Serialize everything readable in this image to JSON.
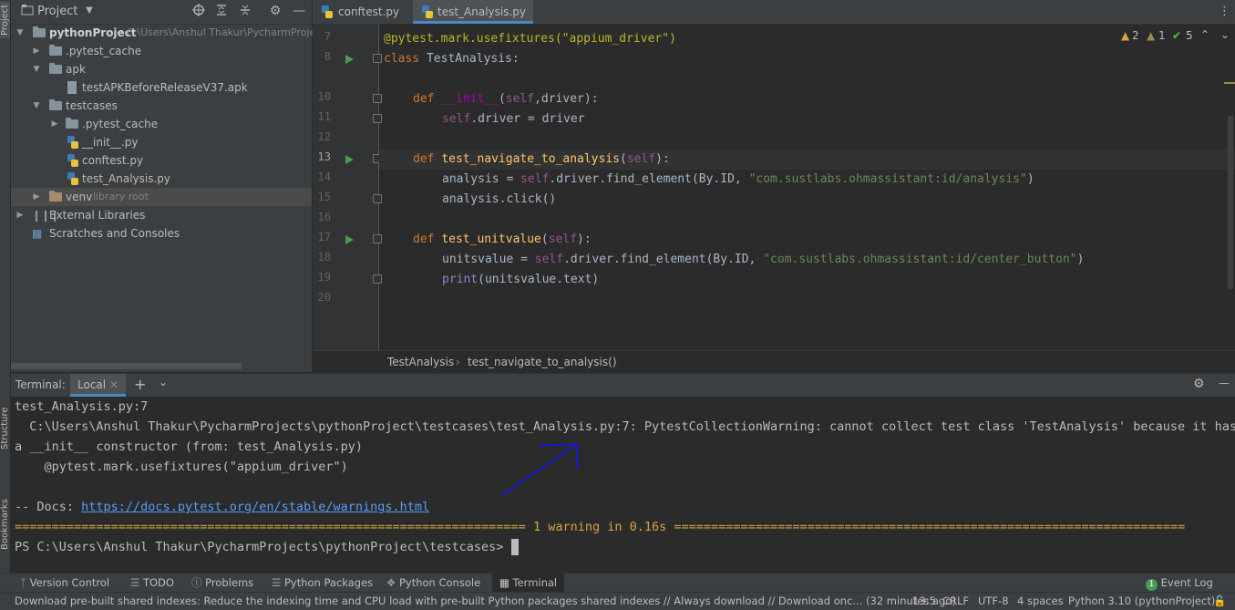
{
  "left_strip": {
    "project_label": "Project",
    "structure_label": "Structure",
    "bookmarks_label": "Bookmarks"
  },
  "project_panel": {
    "title": "Project",
    "tree": [
      {
        "label": "pythonProject",
        "path": "C:\\Users\\Anshul Thakur\\PycharmProje",
        "bold": true
      },
      {
        "label": ".pytest_cache"
      },
      {
        "label": "apk"
      },
      {
        "label": "testAPKBeforeReleaseV37.apk"
      },
      {
        "label": "testcases"
      },
      {
        "label": ".pytest_cache"
      },
      {
        "label": "__init__.py"
      },
      {
        "label": "conftest.py"
      },
      {
        "label": "test_Analysis.py"
      },
      {
        "label": "venv",
        "suffix": "library root"
      },
      {
        "label": "External Libraries"
      },
      {
        "label": "Scratches and Consoles"
      }
    ]
  },
  "editor": {
    "tabs": [
      {
        "label": "conftest.py"
      },
      {
        "label": "test_Analysis.py"
      }
    ],
    "inspections": {
      "warnings": "2",
      "weak": "1",
      "ok": "5"
    },
    "lines": [
      "7",
      "8",
      "10",
      "11",
      "12",
      "13",
      "14",
      "15",
      "16",
      "17",
      "18",
      "19",
      "20"
    ],
    "breadcrumb": [
      "TestAnalysis",
      "test_navigate_to_analysis()"
    ]
  },
  "code": {
    "l7": "@pytest.mark.usefixtures(\"appium_driver\")",
    "l8_kw": "class",
    "l8_name": " TestAnalysis:",
    "l10_def": "def",
    "l10_fn": "__init__",
    "l10_rest_open": "(",
    "l10_self": "self",
    "l10_rest": ",driver):",
    "l11_self": "self",
    "l11_rest": ".driver = driver",
    "l13_def": "def",
    "l13_fn": "test_navigate_to_analysis",
    "l13_open": "(",
    "l13_self": "self",
    "l13_close": "):",
    "l14_a": "analysis = ",
    "l14_self": "self",
    "l14_b": ".driver.find_element(By.ID, ",
    "l14_str": "\"com.sustlabs.ohmassistant:id/analysis\"",
    "l14_c": ")",
    "l15": "analysis.click()",
    "l17_def": "def",
    "l17_fn": "test_unitvalue",
    "l17_open": "(",
    "l17_self": "self",
    "l17_close": "):",
    "l18_a": "unitsvalue = ",
    "l18_self": "self",
    "l18_b": ".driver.find_element(By.ID, ",
    "l18_str": "\"com.sustlabs.ohmassistant:id/center_button\"",
    "l18_c": ")",
    "l19_kw": "print",
    "l19_rest": "(unitsvalue.text)"
  },
  "terminal": {
    "title": "Terminal:",
    "tab": "Local",
    "lines": {
      "t1": "test_Analysis.py:7",
      "t2": "  C:\\Users\\Anshul Thakur\\PycharmProjects\\pythonProject\\testcases\\test_Analysis.py:7: PytestCollectionWarning: cannot collect test class 'TestAnalysis' because it has",
      "t3": "a __init__ constructor (from: test_Analysis.py)",
      "t4": "    @pytest.mark.usefixtures(\"appium_driver\")",
      "t5_prefix": "-- Docs: ",
      "t5_link": "https://docs.pytest.org/en/stable/warnings.html",
      "t6_left": "===================================================================== ",
      "t6_mid_warn": "1 warning",
      "t6_mid_in": " in 0.16s ",
      "t6_right": "=====================================================================",
      "t7": "PS C:\\Users\\Anshul Thakur\\PycharmProjects\\pythonProject\\testcases> "
    }
  },
  "tool_tabs": [
    "Version Control",
    "TODO",
    "Problems",
    "Python Packages",
    "Python Console",
    "Terminal",
    "Event Log"
  ],
  "event_log_count": "1",
  "status": {
    "message": "Download pre-built shared indexes: Reduce the indexing time and CPU load with pre-built Python packages shared indexes // Always download // Download onc... (32 minutes ago)",
    "position": "13:5",
    "line_sep": "CRLF",
    "encoding": "UTF-8",
    "indent": "4 spaces",
    "interpreter": "Python 3.10 (pythonProject)"
  },
  "colors": {
    "accent": "#4a88c7",
    "run": "#499c54",
    "annotation_arrow": "#1a1ad0"
  }
}
